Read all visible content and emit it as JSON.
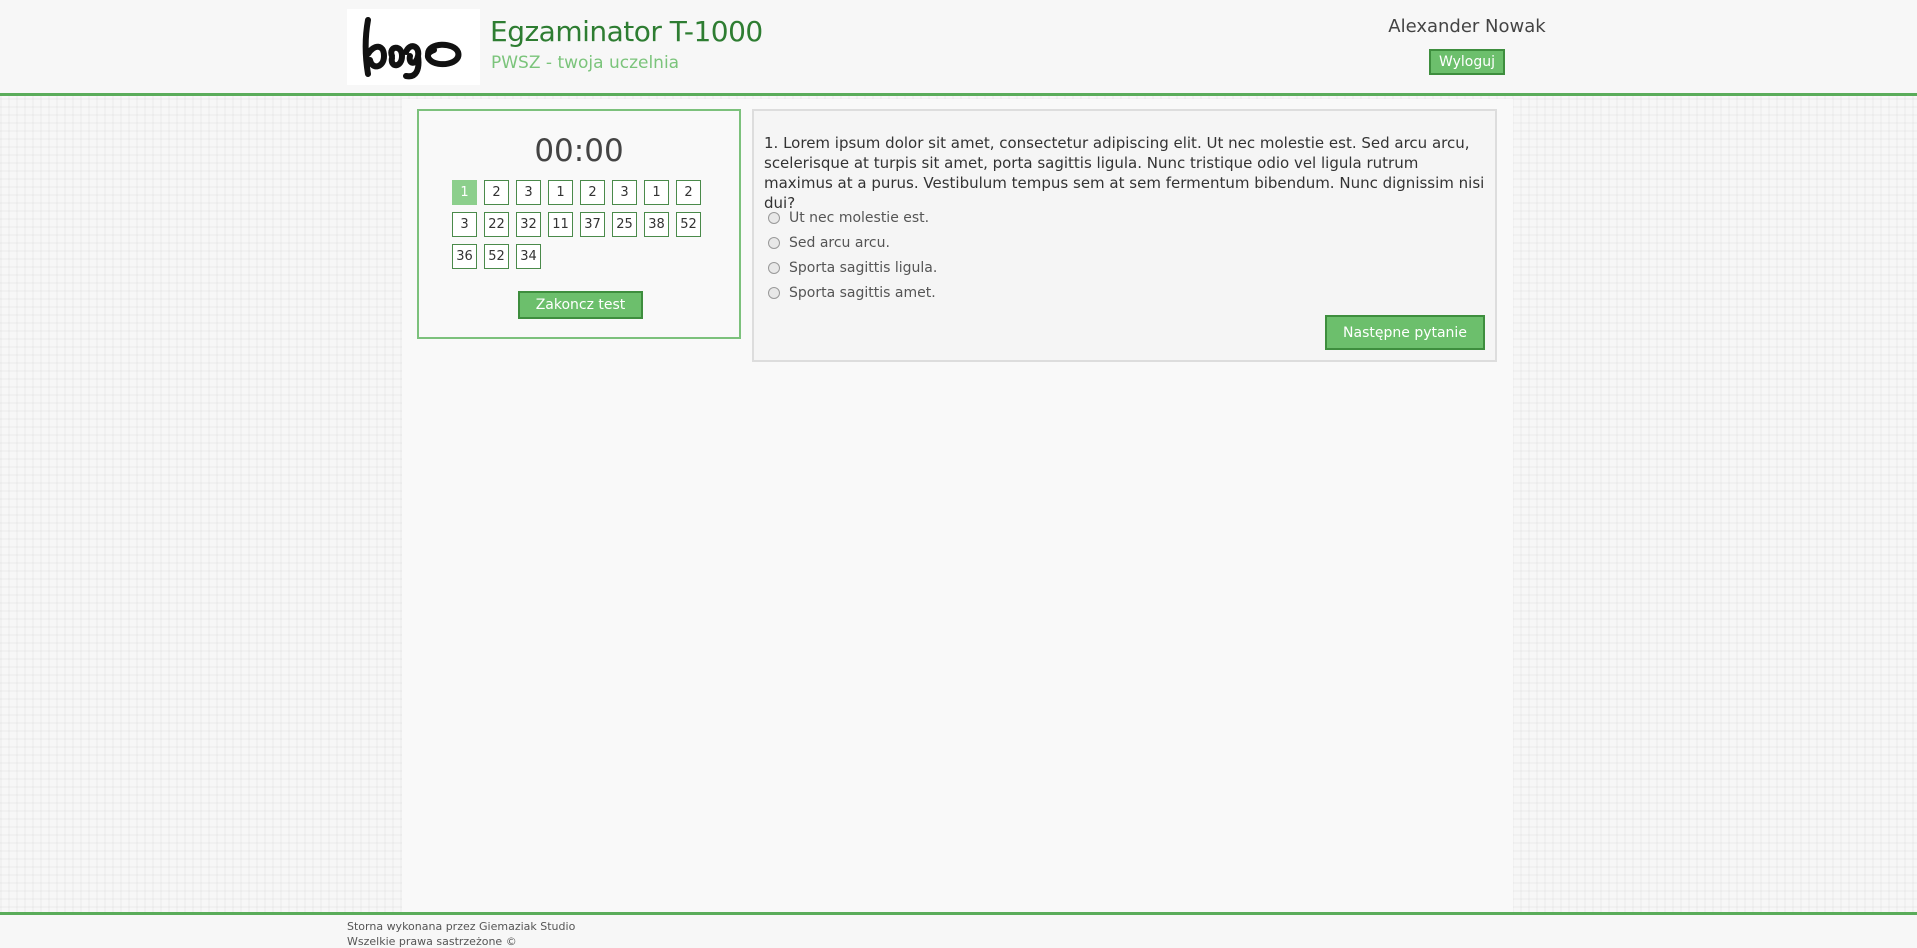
{
  "header": {
    "logo_text": "logo",
    "title": "Egzaminator T-1000",
    "subtitle": "PWSZ - twoja uczelnia",
    "user_name": "Alexander Nowak",
    "logout_label": "Wyloguj"
  },
  "colors": {
    "accent": "#5aac5a",
    "title": "#2e7d32",
    "button_bg": "#6cbf6c",
    "active_question": "#8ccf8c"
  },
  "nav": {
    "timer": "00:00",
    "questions": [
      "1",
      "2",
      "3",
      "1",
      "2",
      "3",
      "1",
      "2",
      "3",
      "22",
      "32",
      "11",
      "37",
      "25",
      "38",
      "52",
      "36",
      "52",
      "34"
    ],
    "active_index": 0,
    "finish_label": "Zakoncz test"
  },
  "question": {
    "text": "1. Lorem ipsum dolor sit amet, consectetur adipiscing elit. Ut nec molestie est. Sed arcu arcu, scelerisque at turpis sit amet, porta sagittis ligula. Nunc tristique odio vel ligula rutrum maximus at a purus. Vestibulum tempus sem at sem fermentum bibendum. Nunc dignissim nisi dui?",
    "answers": [
      "Ut nec molestie est.",
      "Sed arcu arcu.",
      "Sporta sagittis ligula.",
      "Sporta sagittis amet."
    ],
    "next_label": "Następne pytanie"
  },
  "footer": {
    "line1": "Storna wykonana przez Giemaziak Studio",
    "line2": "Wszelkie prawa sastrzeżone ©"
  }
}
